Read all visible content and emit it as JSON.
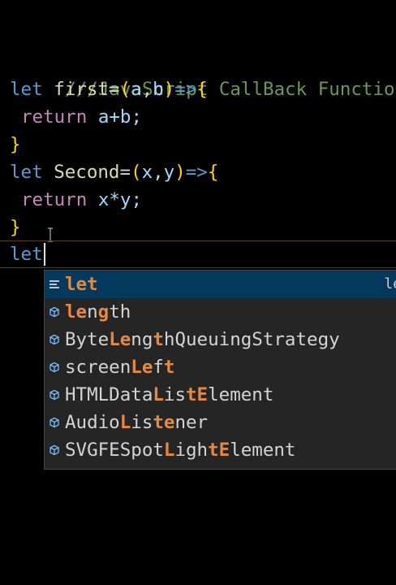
{
  "code": {
    "comment": "///JavaScript CallBack Function",
    "let_kw": "let",
    "return_kw": "return",
    "first_name": "first",
    "second_name": "Second",
    "first_params": [
      "a",
      "b"
    ],
    "second_params": [
      "x",
      "y"
    ],
    "first_body": "a+b;",
    "second_body": "x*y;",
    "close_brace": "}",
    "typed": "let"
  },
  "suggestions": {
    "detail": "le",
    "items": [
      {
        "parts": [
          [
            "let",
            "hl2"
          ]
        ],
        "icon": "keyword-icon"
      },
      {
        "parts": [
          [
            "le",
            "hl2"
          ],
          [
            "n",
            ""
          ],
          [
            "g",
            "hl2"
          ],
          [
            "t",
            ""
          ],
          [
            "h",
            ""
          ]
        ],
        "icon": "variable-icon"
      },
      {
        "parts": [
          [
            "Byte",
            ""
          ],
          [
            "Le",
            "hl2"
          ],
          [
            "ng",
            ""
          ],
          [
            "t",
            "hl2"
          ],
          [
            "hQueuingStrategy",
            ""
          ]
        ],
        "icon": "variable-icon"
      },
      {
        "parts": [
          [
            "screen",
            ""
          ],
          [
            "Le",
            "hl2"
          ],
          [
            "f",
            ""
          ],
          [
            "t",
            "hl2"
          ]
        ],
        "icon": "variable-icon"
      },
      {
        "parts": [
          [
            "HTMLData",
            ""
          ],
          [
            "L",
            "hl2"
          ],
          [
            "is",
            ""
          ],
          [
            "tE",
            "hl2"
          ],
          [
            "lement",
            ""
          ]
        ],
        "icon": "variable-icon"
      },
      {
        "parts": [
          [
            "Audio",
            ""
          ],
          [
            "L",
            "hl2"
          ],
          [
            "is",
            ""
          ],
          [
            "te",
            "hl2"
          ],
          [
            "ner",
            ""
          ]
        ],
        "icon": "variable-icon"
      },
      {
        "parts": [
          [
            "SVGFESpot",
            ""
          ],
          [
            "L",
            "hl2"
          ],
          [
            "igh",
            ""
          ],
          [
            "tE",
            "hl2"
          ],
          [
            "lement",
            ""
          ]
        ],
        "icon": "variable-icon"
      }
    ]
  }
}
